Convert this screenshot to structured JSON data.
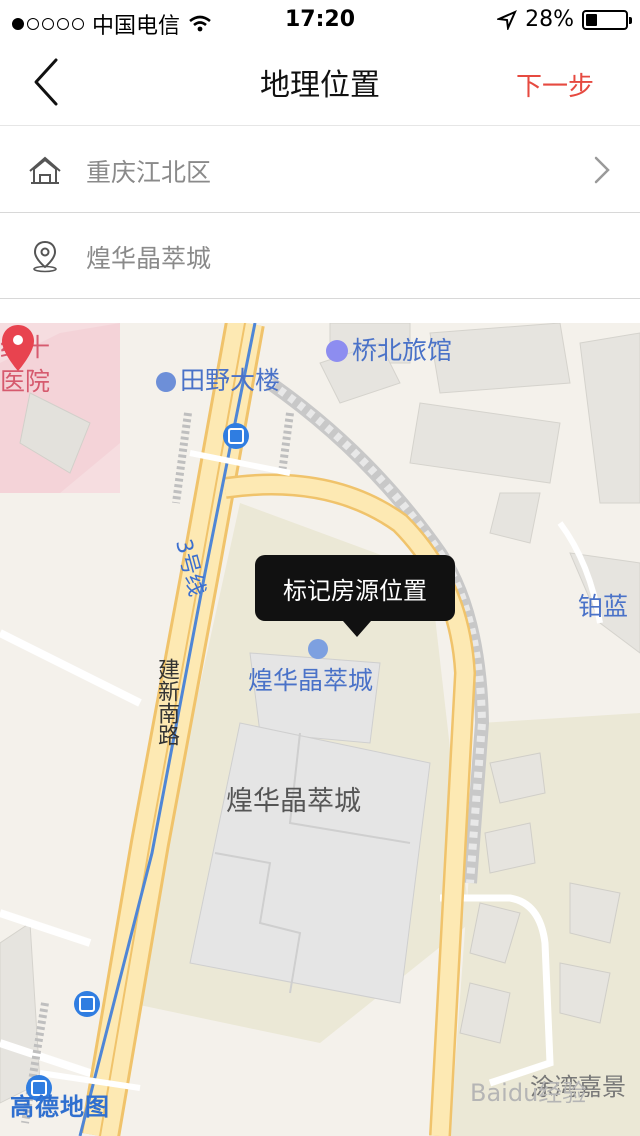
{
  "status_bar": {
    "carrier": "中国电信",
    "time": "17:20",
    "battery": "28%",
    "battery_level": 0.28,
    "signal_bars_filled": 1,
    "signal_bars_total": 5
  },
  "nav": {
    "title": "地理位置",
    "next_label": "下一步",
    "accent_color": "#e64a40"
  },
  "form": {
    "district": "重庆江北区",
    "address": "煌华晶萃城"
  },
  "map": {
    "tooltip": "标记房源位置",
    "pois": {
      "hotel": "桥北旅馆",
      "building": "田野大楼",
      "hospital_line1": "红十",
      "hospital_line2": "医院",
      "complex_poi": "煌华晶萃城",
      "complex_block": "煌华晶萃城",
      "right_poi": "铂蓝",
      "bottom_right": "涂湾嘉景"
    },
    "roads": {
      "line3": "3号线",
      "jianxin": "建新南路"
    },
    "logo": "高德地图",
    "watermark": "Baidu经验"
  },
  "icons": {
    "back": "chevron-left-icon",
    "district": "house-district-icon",
    "location": "location-pin-icon",
    "chevron": "chevron-right-icon"
  }
}
